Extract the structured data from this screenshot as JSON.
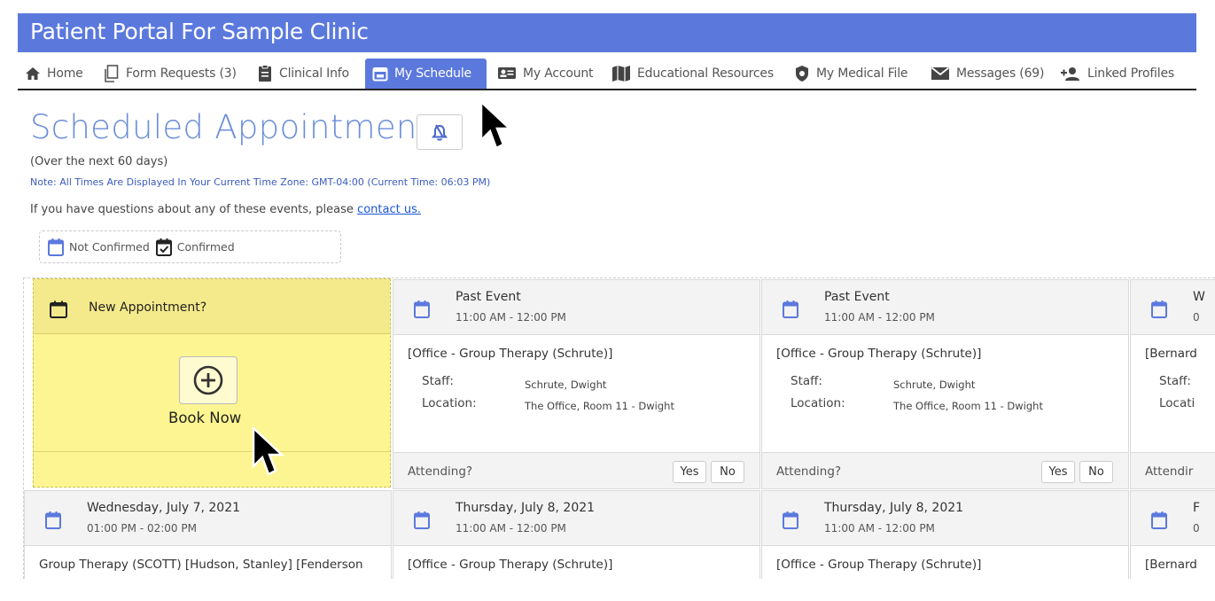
{
  "app": {
    "title": "Patient Portal For Sample Clinic"
  },
  "nav": [
    {
      "label": "Home",
      "icon": "home-icon"
    },
    {
      "label": "Form Requests (3)",
      "icon": "form-requests-icon"
    },
    {
      "label": "Clinical Info",
      "icon": "clinical-info-icon"
    },
    {
      "label": "My Schedule",
      "icon": "calendar-icon",
      "active": true
    },
    {
      "label": "My Account",
      "icon": "account-card-icon"
    },
    {
      "label": "Educational Resources",
      "icon": "map-book-icon"
    },
    {
      "label": "My Medical File",
      "icon": "shield-icon"
    },
    {
      "label": "Messages (69)",
      "icon": "envelope-icon"
    },
    {
      "label": "Linked Profiles",
      "icon": "add-user-icon"
    }
  ],
  "page": {
    "title": "Scheduled Appointments",
    "subtitle": "(Over the next 60 days)",
    "timezone_note": "Note: All Times Are Displayed In Your Current Time Zone: GMT-04:00 (Current Time: 06:03 PM)",
    "questions_prefix": "If you have questions about any of these events, please",
    "contact_link": "contact us."
  },
  "legend": {
    "not_confirmed": "Not Confirmed",
    "confirmed": "Confirmed"
  },
  "new_appointment": {
    "title": "New Appointment?",
    "book_label": "Book Now"
  },
  "labels": {
    "staff": "Staff:",
    "location": "Location:",
    "attending": "Attending?",
    "yes": "Yes",
    "no": "No"
  },
  "row1": [
    {
      "title": "Past Event",
      "time": "11:00 AM - 12:00 PM",
      "description": "[Office - Group Therapy (Schrute)]",
      "staff": "Schrute, Dwight",
      "location": "The Office, Room 11 - Dwight"
    },
    {
      "title": "Past Event",
      "time": "11:00 AM - 12:00 PM",
      "description": "[Office - Group Therapy (Schrute)]",
      "staff": "Schrute, Dwight",
      "location": "The Office, Room 11 - Dwight"
    },
    {
      "title": "W",
      "time": "0",
      "description": "[Bernard",
      "staff_label": "Staff:",
      "location_label": "Locati",
      "attending_label": "Attendir"
    }
  ],
  "row2": [
    {
      "title": "Wednesday, July 7, 2021",
      "time": "01:00 PM - 02:00 PM",
      "description": "Group Therapy (SCOTT) [Hudson, Stanley] [Fenderson"
    },
    {
      "title": "Thursday, July 8, 2021",
      "time": "11:00 AM - 12:00 PM",
      "description": "[Office - Group Therapy (Schrute)]"
    },
    {
      "title": "Thursday, July 8, 2021",
      "time": "11:00 AM - 12:00 PM",
      "description": "[Office - Group Therapy (Schrute)]"
    },
    {
      "title": "F",
      "time": "0",
      "description": "[Bernard"
    }
  ],
  "colors": {
    "brand": "#5b79dd",
    "title_blue": "#6b8ed9",
    "highlight_yellow": "#fdf591",
    "calendar_icon": "#5b79dd"
  }
}
